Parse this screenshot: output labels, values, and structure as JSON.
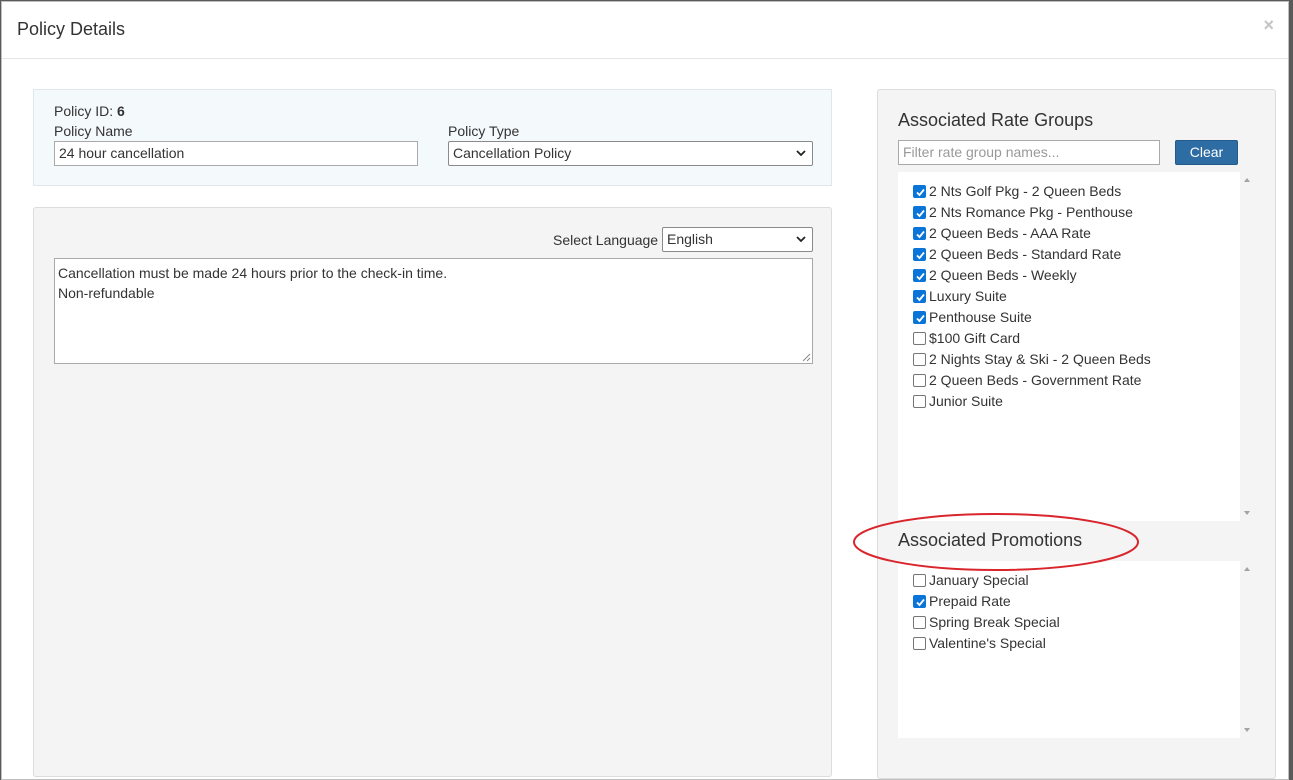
{
  "modal": {
    "title": "Policy Details",
    "close_label": "×"
  },
  "policy": {
    "id_label": "Policy ID:",
    "id_value": "6",
    "name_label": "Policy Name",
    "name_value": "24 hour cancellation",
    "type_label": "Policy Type",
    "type_value": "Cancellation Policy"
  },
  "text_section": {
    "language_label": "Select Language",
    "language_value": "English",
    "text_line1": "Cancellation must be made 24 hours prior to the check-in time.",
    "text_line2": "Non-refundable"
  },
  "rate_groups": {
    "title": "Associated Rate Groups",
    "filter_placeholder": "Filter rate group names...",
    "clear_label": "Clear",
    "items": [
      {
        "label": "2 Nts Golf Pkg - 2 Queen Beds",
        "checked": true
      },
      {
        "label": "2 Nts Romance Pkg - Penthouse",
        "checked": true
      },
      {
        "label": "2 Queen Beds - AAA Rate",
        "checked": true
      },
      {
        "label": "2 Queen Beds - Standard Rate",
        "checked": true
      },
      {
        "label": "2 Queen Beds - Weekly",
        "checked": true
      },
      {
        "label": "Luxury Suite",
        "checked": true
      },
      {
        "label": "Penthouse Suite",
        "checked": true
      },
      {
        "label": "$100 Gift Card",
        "checked": false
      },
      {
        "label": "2 Nights Stay & Ski - 2 Queen Beds",
        "checked": false
      },
      {
        "label": "2 Queen Beds - Government Rate",
        "checked": false
      },
      {
        "label": "Junior Suite",
        "checked": false
      }
    ]
  },
  "promotions": {
    "title": "Associated Promotions",
    "items": [
      {
        "label": "January Special",
        "checked": false
      },
      {
        "label": "Prepaid Rate",
        "checked": true
      },
      {
        "label": "Spring Break Special",
        "checked": false
      },
      {
        "label": "Valentine's Special",
        "checked": false
      }
    ]
  },
  "colors": {
    "accent": "#2e6da4",
    "checkbox_checked": "#0a75d8",
    "annotation": "#d9262c"
  }
}
